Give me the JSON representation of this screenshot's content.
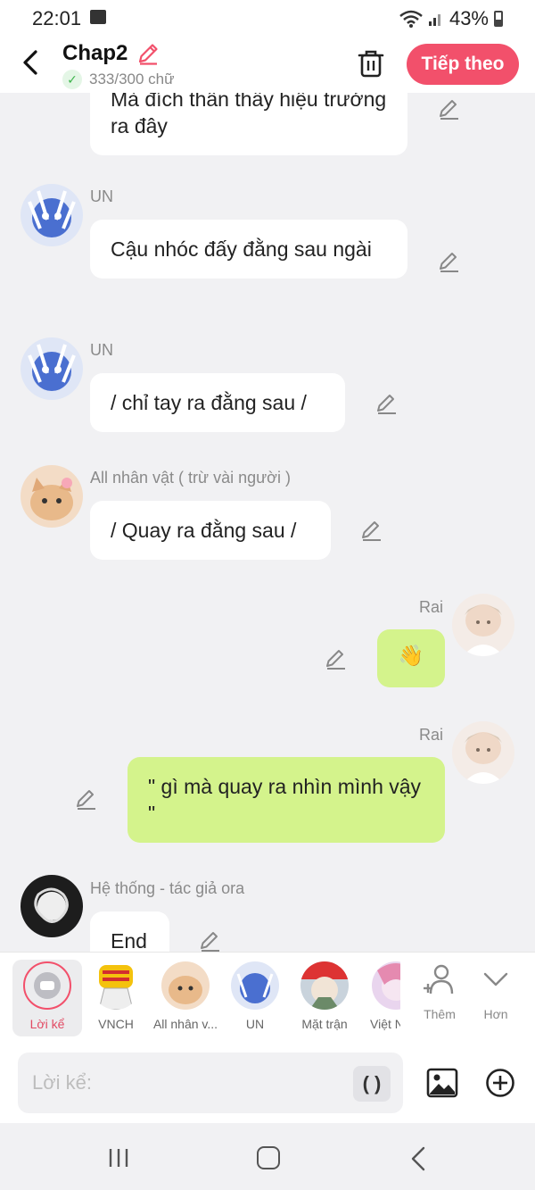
{
  "status_bar": {
    "time": "22:01",
    "battery": "43%"
  },
  "header": {
    "title": "Chap2",
    "word_count": "333/300 chữ",
    "next_label": "Tiếp theo"
  },
  "messages": [
    {
      "text": "Mà đích thân thầy hiệu trưởng ra đây",
      "side": "left"
    },
    {
      "sender": "UN",
      "text": "Cậu nhóc đấy đằng sau ngài",
      "side": "left"
    },
    {
      "sender": "UN",
      "text": "/ chỉ tay ra đằng sau /",
      "side": "left"
    },
    {
      "sender": "All nhân vật ( trừ vài người )",
      "text": "/ Quay ra đằng sau /",
      "side": "left"
    },
    {
      "sender": "Rai",
      "text": "👋",
      "side": "right"
    },
    {
      "sender": "Rai",
      "text": "\" gì mà quay ra nhìn mình vậy \"",
      "side": "right"
    },
    {
      "sender": "Hệ thống - tác giả ora",
      "text": "End",
      "side": "left"
    }
  ],
  "characters": [
    {
      "label": "Lời kể",
      "selected": true
    },
    {
      "label": "VNCH"
    },
    {
      "label": "All nhân v..."
    },
    {
      "label": "UN"
    },
    {
      "label": "Mặt trận"
    },
    {
      "label": "Việt N"
    }
  ],
  "more_actions": {
    "add_label": "Thêm",
    "more_label": "Hơn"
  },
  "input": {
    "placeholder": "Lời kể:",
    "paren_label": "( )"
  },
  "colors": {
    "accent": "#f2506b",
    "bubble_self": "#d4f38c",
    "bubble_other": "#ffffff"
  }
}
